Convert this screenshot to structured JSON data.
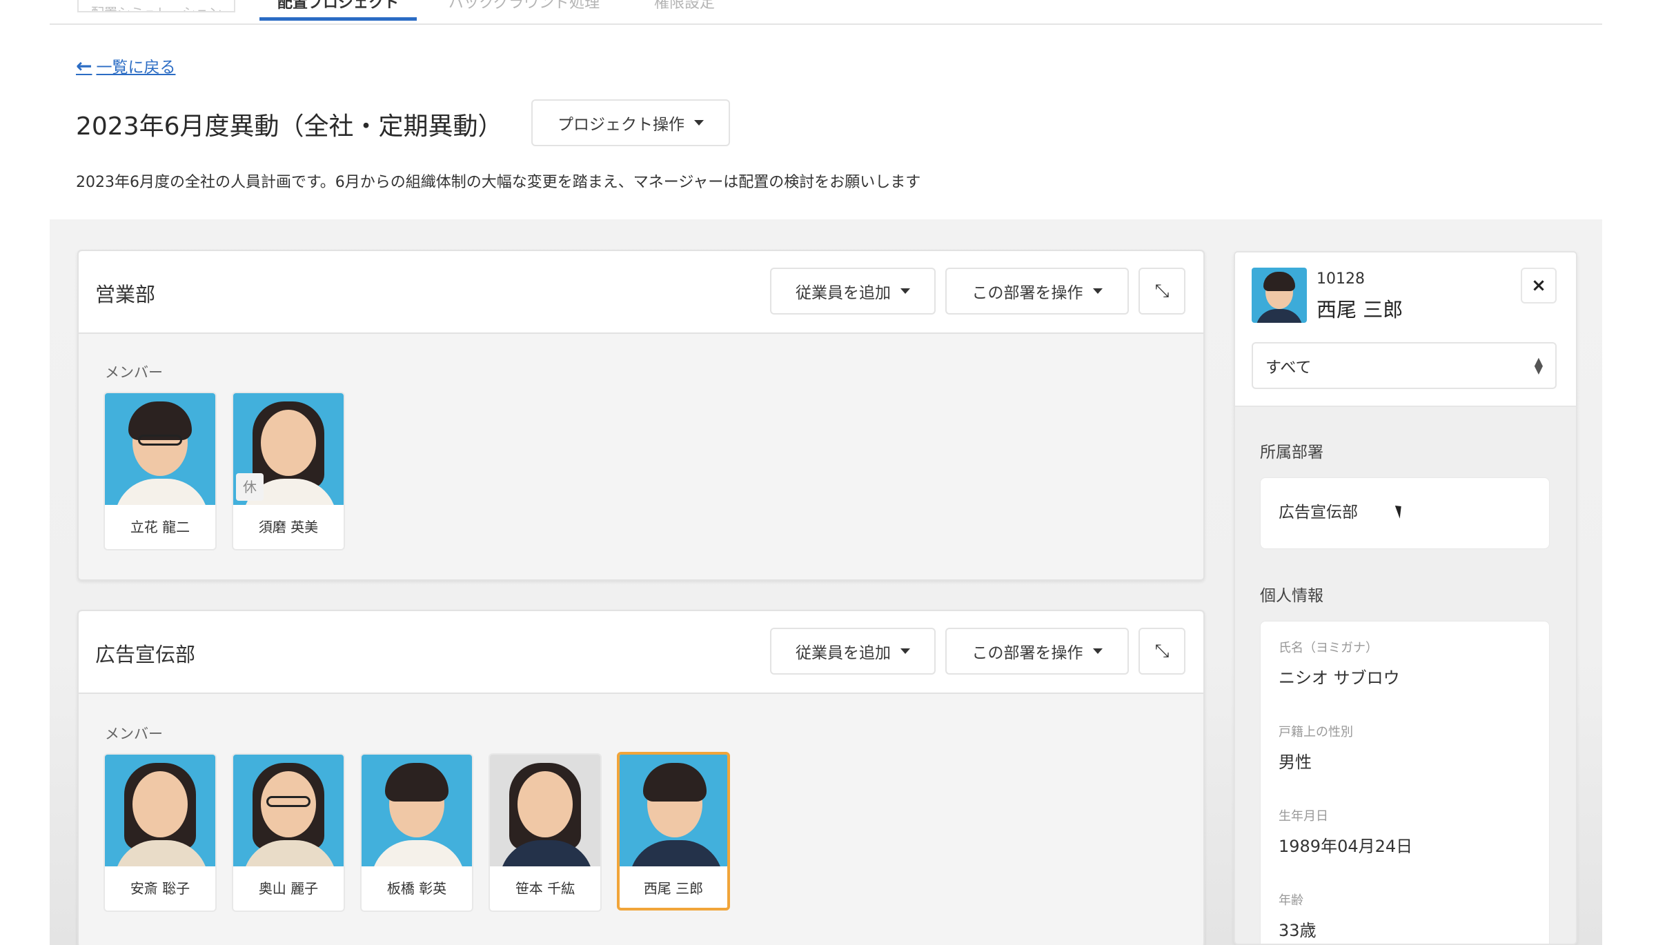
{
  "tabs": [
    {
      "label": "配置シミュレーション"
    },
    {
      "label": "配置プロジェクト"
    },
    {
      "label": "バックグラウンド処理"
    },
    {
      "label": "権限設定"
    }
  ],
  "header": {
    "back_label": "一覧に戻る",
    "title": "2023年6月度異動（全社・定期異動）",
    "project_action_label": "プロジェクト操作",
    "description": "2023年6月度の全社の人員計画です。6月からの組織体制の大幅な変更を踏まえ、マネージャーは配置の検討をお願いします"
  },
  "departments": [
    {
      "name": "営業部",
      "add_employee_label": "従業員を追加",
      "dept_action_label": "この部署を操作",
      "members_label": "メンバー",
      "members": [
        {
          "name": "立花 龍二"
        },
        {
          "name": "須磨 英美",
          "badge": "休"
        }
      ]
    },
    {
      "name": "広告宣伝部",
      "add_employee_label": "従業員を追加",
      "dept_action_label": "この部署を操作",
      "members_label": "メンバー",
      "members": [
        {
          "name": "安斎 聡子"
        },
        {
          "name": "奥山 麗子"
        },
        {
          "name": "板橋 彰英"
        },
        {
          "name": "笹本 千紘"
        },
        {
          "name": "西尾 三郎"
        }
      ]
    }
  ],
  "panel": {
    "employee_id": "10128",
    "employee_name": "西尾 三郎",
    "close_label": "×",
    "filter_value": "すべて",
    "dept_section_label": "所属部署",
    "dept_value": "広告宣伝部",
    "personal_section_label": "個人情報",
    "fields": [
      {
        "label": "氏名（ヨミガナ）",
        "value": "ニシオ サブロウ"
      },
      {
        "label": "戸籍上の性別",
        "value": "男性"
      },
      {
        "label": "生年月日",
        "value": "1989年04月24日"
      },
      {
        "label": "年齢",
        "value": "33歳"
      }
    ]
  },
  "colors": {
    "accent": "#2b6cc4",
    "selected_border": "#f1a53a",
    "photo_bg": "#42b0dc"
  },
  "icons": {
    "back": "arrow-left-icon",
    "dropdown": "caret-down-icon",
    "collapse": "collapse-arrows-icon",
    "close": "close-icon",
    "sort": "sort-arrows-icon"
  }
}
